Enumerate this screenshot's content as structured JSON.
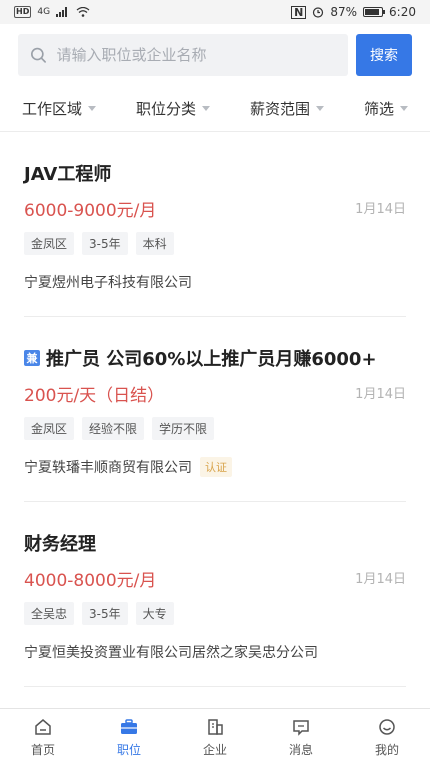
{
  "status_bar": {
    "left_badge": "HD",
    "signal_label": "4G",
    "nfc": "N",
    "battery_percent": "87%",
    "battery_level": 0.87,
    "time": "6:20"
  },
  "search": {
    "placeholder": "请输入职位或企业名称",
    "button_label": "搜索"
  },
  "filters": [
    {
      "label": "工作区域"
    },
    {
      "label": "职位分类"
    },
    {
      "label": "薪资范围"
    },
    {
      "label": "筛选"
    }
  ],
  "jobs": [
    {
      "title": "JAV工程师",
      "badge": "",
      "salary": "6000-9000元/月",
      "date": "1月14日",
      "tags": [
        "金凤区",
        "3-5年",
        "本科"
      ],
      "company": "宁夏煜州电子科技有限公司",
      "verified": ""
    },
    {
      "title": "推广员 公司60%以上推广员月赚6000+",
      "badge": "兼",
      "salary": "200元/天（日结）",
      "date": "1月14日",
      "tags": [
        "金凤区",
        "经验不限",
        "学历不限"
      ],
      "company": "宁夏轶璠丰顺商贸有限公司",
      "verified": "认证"
    },
    {
      "title": "财务经理",
      "badge": "",
      "salary": "4000-8000元/月",
      "date": "1月14日",
      "tags": [
        "全吴忠",
        "3-5年",
        "大专"
      ],
      "company": "宁夏恒美投资置业有限公司居然之家吴忠分公司",
      "verified": ""
    }
  ],
  "tabs": [
    {
      "label": "首页",
      "icon": "home-icon"
    },
    {
      "label": "职位",
      "icon": "briefcase-icon",
      "active": true
    },
    {
      "label": "企业",
      "icon": "building-icon"
    },
    {
      "label": "消息",
      "icon": "message-icon"
    },
    {
      "label": "我的",
      "icon": "profile-icon"
    }
  ],
  "colors": {
    "accent": "#3678e6",
    "salary": "#d9534f",
    "verified": "#d8a34a"
  }
}
